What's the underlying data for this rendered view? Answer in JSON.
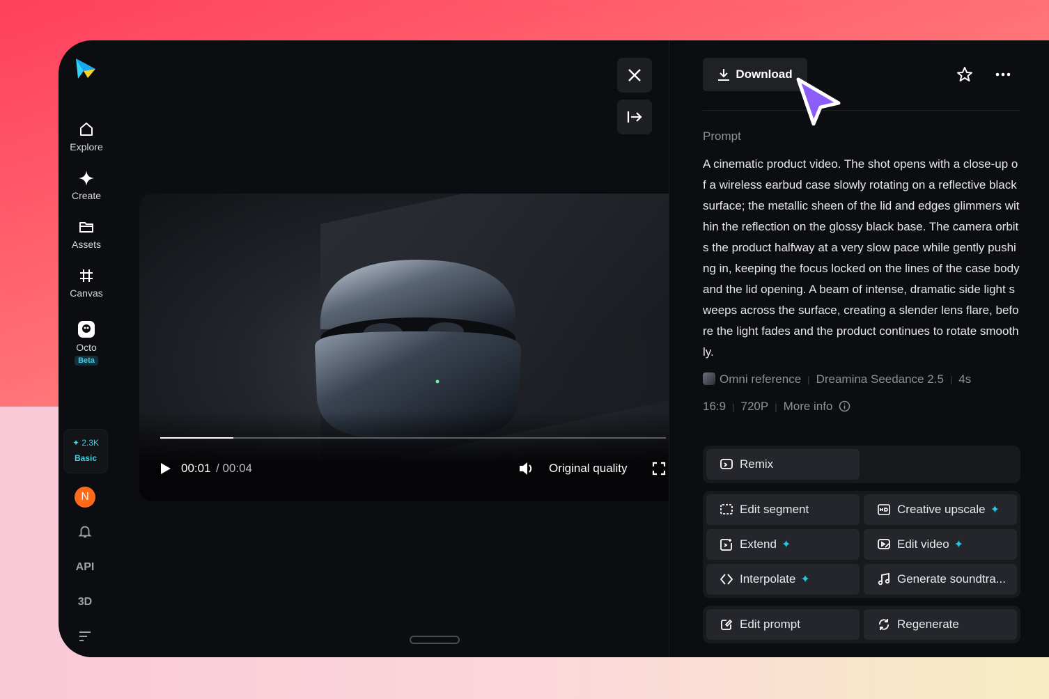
{
  "sidebar": {
    "items": [
      {
        "label": "Explore"
      },
      {
        "label": "Create"
      },
      {
        "label": "Assets"
      },
      {
        "label": "Canvas"
      },
      {
        "label": "Octo",
        "badge": "Beta"
      }
    ],
    "credits": {
      "amount": "2.3K",
      "plan": "Basic"
    },
    "avatar_letter": "N",
    "api_label": "API",
    "threed_label": "3D"
  },
  "player": {
    "current_time": "00:01",
    "total_time": "/ 00:04",
    "quality": "Original quality",
    "progress": 0.145
  },
  "panel": {
    "download_label": "Download",
    "prompt_label": "Prompt",
    "prompt_text": "A cinematic product video. The shot opens with a close-up of a wireless earbud case slowly rotating on a reflective black surface; the metallic sheen of the lid and edges glimmers within the reflection on the glossy black base. The camera orbits the product halfway at a very slow pace while gently pushing in, keeping the focus locked on the lines of the case body and the lid opening. A beam of intense, dramatic side light sweeps across the surface, creating a slender lens flare, before the light fades and the product continues to rotate smoothly.",
    "meta_row1": {
      "reference": "Omni reference",
      "model": "Dreamina Seedance 2.5",
      "duration": "4s"
    },
    "meta_row2": {
      "ratio": "16:9",
      "resolution": "720P",
      "more_info": "More info"
    },
    "actions": {
      "remix": "Remix",
      "edit_segment": "Edit segment",
      "creative_upscale": "Creative upscale",
      "extend": "Extend",
      "edit_video": "Edit video",
      "interpolate": "Interpolate",
      "generate_soundtrack": "Generate soundtra...",
      "edit_prompt": "Edit prompt",
      "regenerate": "Regenerate"
    }
  },
  "colors": {
    "accent": "#26c6e0",
    "cursor": "#8b5cf6",
    "avatar": "#ff6a1a"
  }
}
